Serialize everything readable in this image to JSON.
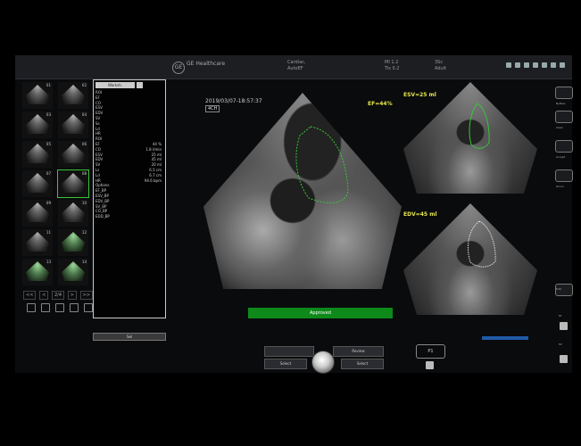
{
  "header": {
    "brand": "GE Healthcare",
    "exam_line1": "Cardiac,",
    "exam_line2": "AutoEF",
    "mi": "MI 1.2",
    "tis": "Tis 0.2",
    "line3a": "3Sc",
    "line3b": "Adult"
  },
  "thumbnails": {
    "nav_prev2": "<<",
    "nav_prev": "<",
    "page": "2/4",
    "nav_next": ">",
    "nav_next2": ">>",
    "items": [
      {
        "num": "01"
      },
      {
        "num": "02"
      },
      {
        "num": "03"
      },
      {
        "num": "04"
      },
      {
        "num": "05"
      },
      {
        "num": "06"
      },
      {
        "num": "07"
      },
      {
        "num": "08"
      },
      {
        "num": "09"
      },
      {
        "num": "10"
      },
      {
        "num": "11"
      },
      {
        "num": "12"
      },
      {
        "num": "13"
      },
      {
        "num": "14"
      }
    ]
  },
  "measurements": {
    "header": "Worksh.",
    "rows": [
      {
        "label": "ROI",
        "value": ""
      },
      {
        "label": "EF",
        "value": ""
      },
      {
        "label": "CO",
        "value": ""
      },
      {
        "label": "ESV",
        "value": ""
      },
      {
        "label": "EDV",
        "value": ""
      },
      {
        "label": "SV",
        "value": ""
      },
      {
        "label": "Ss",
        "value": ""
      },
      {
        "label": "Ld",
        "value": ""
      },
      {
        "label": "HR",
        "value": ""
      },
      {
        "label": "ROI",
        "value": ""
      },
      {
        "label": "EF",
        "value": "44 %"
      },
      {
        "label": "CO",
        "value": "1.8 l/min"
      },
      {
        "label": "ESV",
        "value": "25 ml"
      },
      {
        "label": "EDV",
        "value": "45 ml"
      },
      {
        "label": "SV",
        "value": "20 ml"
      },
      {
        "label": "Ls",
        "value": "6.5 cm"
      },
      {
        "label": "Ld",
        "value": "6.7 cm"
      },
      {
        "label": "HR",
        "value": "94.6 bpm"
      },
      {
        "label": "Options",
        "value": ""
      },
      {
        "label": "EF_BP",
        "value": ""
      },
      {
        "label": "ESV_BP",
        "value": ""
      },
      {
        "label": "EDV_BP",
        "value": ""
      },
      {
        "label": "SV_BP",
        "value": ""
      },
      {
        "label": "CO_BP",
        "value": ""
      },
      {
        "label": "EDD_BP",
        "value": ""
      }
    ],
    "footer": "Sel"
  },
  "main_image": {
    "timestamp": "2019/03/07-18:57:37",
    "view": "4CH",
    "ef": "EF=44%",
    "approved": "Approved"
  },
  "esv_image": {
    "label": "ESV=25 ml"
  },
  "edv_image": {
    "label": "EDV=45 ml"
  },
  "controls": {
    "left_top": "",
    "left_bottom": "Select",
    "right_top": "Review",
    "right_bottom": "Select",
    "p1": "P1"
  },
  "right_panel": {
    "b1": "ByPass",
    "b2": "Clear",
    "b3": "Accept",
    "b4": "Zoom",
    "b5": "Edit",
    "p1": "P1",
    "p2": "P2"
  },
  "colors": {
    "accent_green": "#0e8a1b",
    "label_yellow": "#e6e64a",
    "trace_green": "#3ac43a"
  }
}
